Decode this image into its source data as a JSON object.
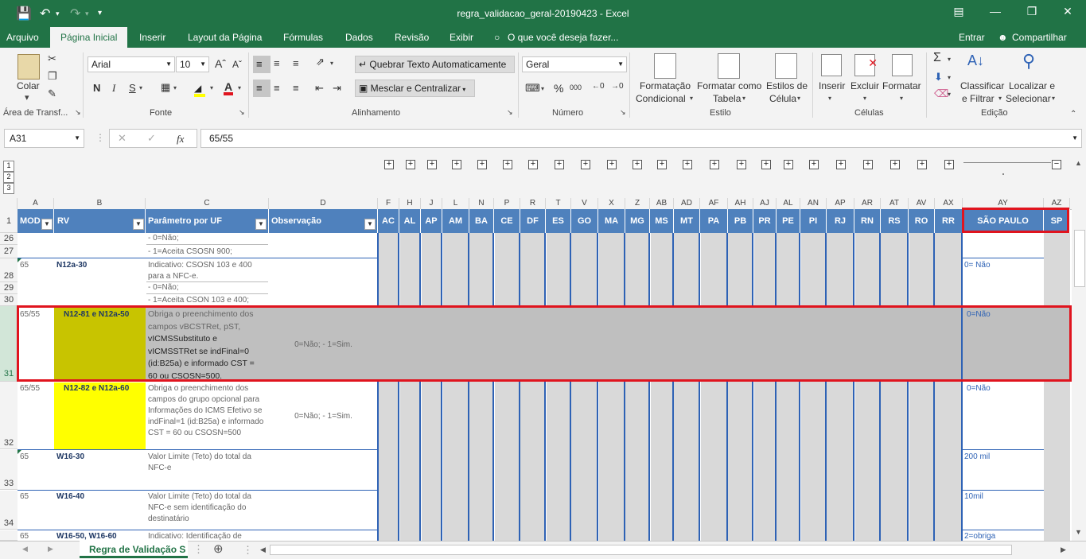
{
  "title_bar": {
    "title": "regra_validacao_geral-20190423 - Excel"
  },
  "menu": {
    "tabs": [
      "Arquivo",
      "Página Inicial",
      "Inserir",
      "Layout da Página",
      "Fórmulas",
      "Dados",
      "Revisão",
      "Exibir"
    ],
    "tell_me": "O que você deseja fazer...",
    "signin": "Entrar",
    "share": "Compartilhar"
  },
  "ribbon": {
    "clipboard": {
      "paste": "Colar",
      "group": "Área de Transf..."
    },
    "font": {
      "name": "Arial",
      "size": "10",
      "bold": "N",
      "italic": "I",
      "underline": "S",
      "group": "Fonte"
    },
    "alignment": {
      "wrap": "Quebrar Texto Automaticamente",
      "merge": "Mesclar e Centralizar",
      "group": "Alinhamento"
    },
    "number": {
      "format": "Geral",
      "group": "Número"
    },
    "styles": {
      "cond1": "Formatação",
      "cond2": "Condicional",
      "table1": "Formatar como",
      "table2": "Tabela",
      "cell1": "Estilos de",
      "cell2": "Célula",
      "group": "Estilo"
    },
    "cells": {
      "insert": "Inserir",
      "delete": "Excluir",
      "format": "Formatar",
      "group": "Células"
    },
    "editing": {
      "sort1": "Classificar",
      "sort2": "e Filtrar",
      "find1": "Localizar e",
      "find2": "Selecionar",
      "group": "Edição"
    }
  },
  "formula_bar": {
    "name_box": "A31",
    "fx": "fx",
    "formula": "65/55"
  },
  "outline_levels": [
    "1",
    "2",
    "3"
  ],
  "columns": [
    "A",
    "B",
    "C",
    "D",
    "F",
    "H",
    "J",
    "L",
    "N",
    "P",
    "R",
    "T",
    "V",
    "X",
    "Z",
    "AB",
    "AD",
    "AF",
    "AH",
    "AJ",
    "AL",
    "AN",
    "AP",
    "AR",
    "AT",
    "AV",
    "AX",
    "AY",
    "AZ"
  ],
  "header_row": {
    "row_num": "1",
    "mod": "MOD",
    "rv": "RV",
    "param": "Parâmetro por UF",
    "obs": "Observação",
    "states": [
      "AC",
      "AL",
      "AP",
      "AM",
      "BA",
      "CE",
      "DF",
      "ES",
      "GO",
      "MA",
      "MG",
      "MS",
      "MT",
      "PA",
      "PB",
      "PR",
      "PE",
      "PI",
      "RJ",
      "RN",
      "RS",
      "RO",
      "RR"
    ],
    "sp_full": "SÃO PAULO",
    "sp": "SP"
  },
  "rows": {
    "r26": {
      "num": "26",
      "param": "- 0=Não;"
    },
    "r27": {
      "num": "27",
      "param": "- 1=Aceita CSOSN 900;"
    },
    "r28": {
      "num": "28",
      "mod": "65",
      "rv": "N12a-30",
      "param": "Indicativo: CSOSN 103 e 400 para a NFC-e.",
      "sp": "0= Não"
    },
    "r29": {
      "num": "29",
      "param": "- 0=Não;"
    },
    "r30": {
      "num": "30",
      "param": "- 1=Aceita CSON 103 e 400;"
    },
    "r31": {
      "num": "31",
      "mod": "65/55",
      "rv": "N12-81 e N12a-50",
      "param_l1": "Obriga o preenchimento dos",
      "param_l2": "campos vBCSTRet, pST,",
      "param_l3": "vICMSSubstituto e",
      "param_l4": "vICMSSTRet se indFinal=0",
      "param_l5": "(id:B25a) e informado CST =",
      "param_l6": "60 ou CSOSN=500.",
      "obs": "0=Não; - 1=Sim.",
      "sp": "0=Não"
    },
    "r32": {
      "num": "32",
      "mod": "65/55",
      "rv": "N12-82 e N12a-60",
      "param": "Obriga o preenchimento dos campos do grupo opcional para Informações do ICMS Efetivo se indFinal=1 (id:B25a) e informado CST = 60 ou CSOSN=500",
      "obs": "0=Não; - 1=Sim.",
      "sp": "0=Não"
    },
    "r33": {
      "num": "33",
      "mod": "65",
      "rv": "W16-30",
      "param": "Valor Limite (Teto) do total da NFC-e",
      "sp": "200 mil"
    },
    "r34": {
      "num": "34",
      "mod": "65",
      "rv": "W16-40",
      "param": "Valor Limite (Teto) do total da NFC-e sem identificação do destinatário",
      "sp": "10mil"
    },
    "r35": {
      "mod": "65",
      "rv": "W16-50, W16-60",
      "param": "Indicativo: Identificação de",
      "sp": "2=obriga"
    }
  },
  "sheet_tab": "Regra de Validação S",
  "colors": {
    "excel_green": "#217346",
    "header_blue": "#4f81bd",
    "highlight_red": "#e0141e",
    "olive": "#c8c400",
    "yellow": "#ffff00",
    "gray_row": "#bfbfbf"
  }
}
